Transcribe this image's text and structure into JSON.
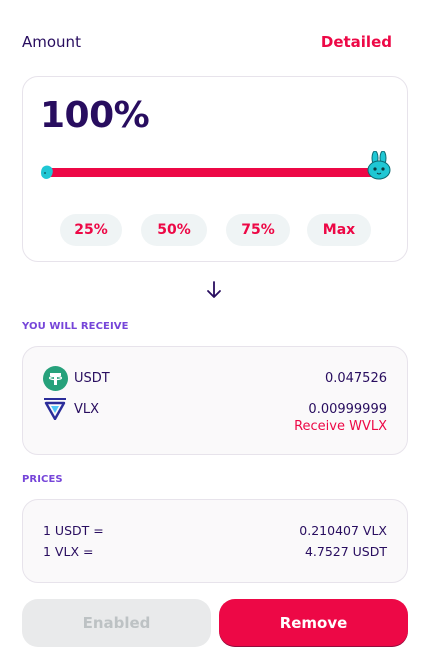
{
  "header": {
    "amount_label": "Amount",
    "detailed_label": "Detailed"
  },
  "amount": {
    "percent_text": "100%",
    "slider_value_percent": 100,
    "buttons": [
      "25%",
      "50%",
      "75%",
      "Max"
    ]
  },
  "receive": {
    "section_label": "YOU WILL RECEIVE",
    "tokens": [
      {
        "symbol": "USDT",
        "amount": "0.047526",
        "icon": "tether-icon"
      },
      {
        "symbol": "VLX",
        "amount": "0.00999999",
        "icon": "velas-icon"
      }
    ],
    "receive_wvlx_label": "Receive WVLX"
  },
  "prices": {
    "section_label": "PRICES",
    "rows": [
      {
        "label": "1 USDT =",
        "value": "0.210407 VLX"
      },
      {
        "label": "1 VLX =",
        "value": "4.7527 USDT"
      }
    ]
  },
  "actions": {
    "enabled_label": "Enabled",
    "remove_label": "Remove"
  },
  "colors": {
    "accent": "#ed0846",
    "text": "#280d5f",
    "secondary": "#7645d9",
    "tether": "#26a17b",
    "velas": "#2b2d9a",
    "mascot": "#1fc7d4"
  }
}
